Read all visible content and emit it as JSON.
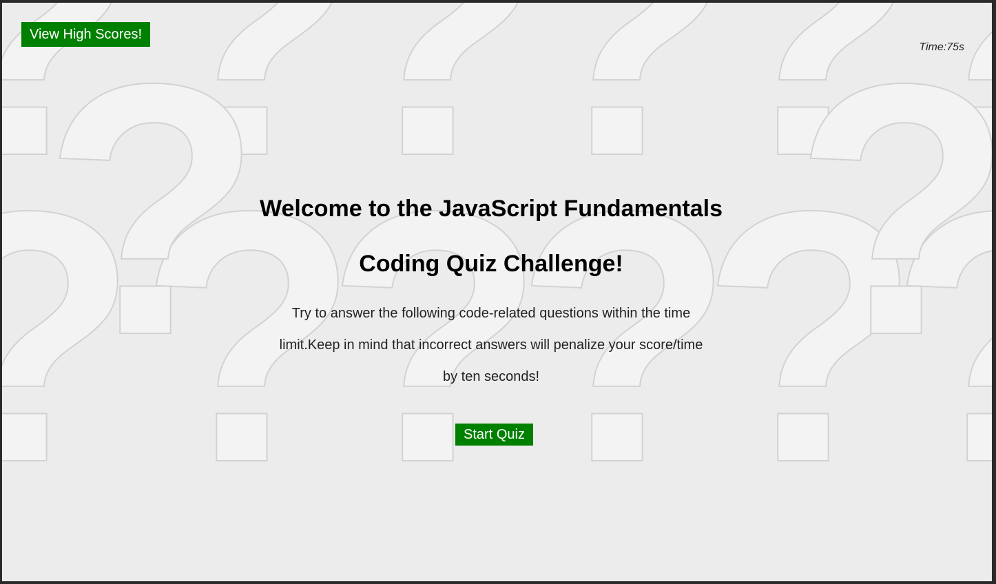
{
  "header": {
    "high_scores_label": "View High Scores!",
    "timer_text": "Time:75s"
  },
  "welcome": {
    "title_line1": "Welcome to the JavaScript Fundamentals",
    "title_line2": "Coding Quiz Challenge!",
    "description": "Try to answer the following code-related questions within the time limit.Keep in mind that incorrect answers will penalize your score/time by ten seconds!",
    "start_label": "Start Quiz"
  },
  "background": {
    "pattern_icon": "question-mark-icon",
    "pattern_glyph": "?"
  },
  "colors": {
    "button_green": "#008000",
    "background": "#ececec"
  }
}
